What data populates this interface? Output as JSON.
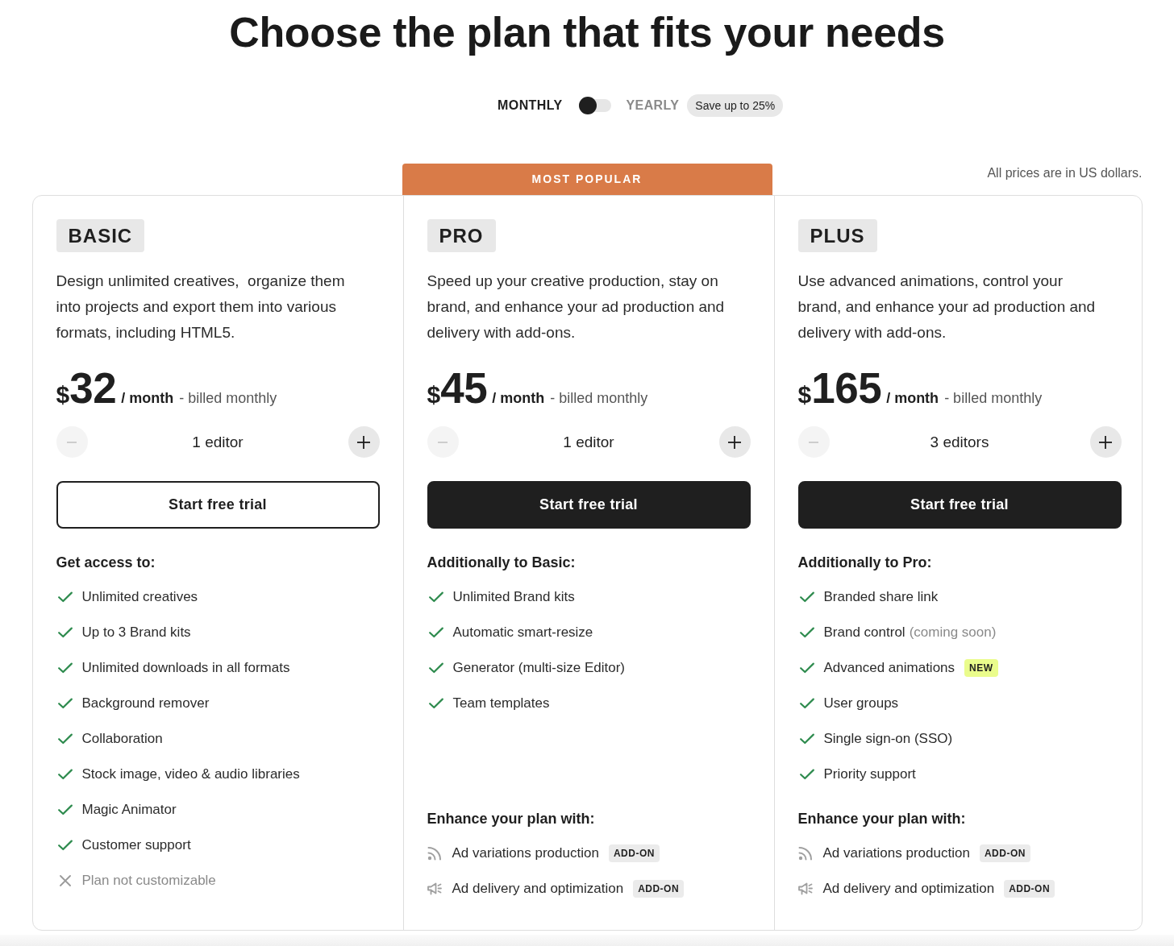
{
  "heading": "Choose the plan that fits your needs",
  "billing_toggle": {
    "options": [
      {
        "label": "MONTHLY",
        "selected": true
      },
      {
        "label": "YEARLY",
        "selected": false
      }
    ],
    "badge": "Save up to 25%"
  },
  "price_note": "All prices are in US dollars.",
  "plans": [
    {
      "name": "BASIC",
      "description": "Design unlimited creatives,  organize them into projects and export them into various formats, including HTML5.",
      "price": {
        "currency": "$",
        "amount": "32",
        "period": "/ month",
        "billing": "- billed monthly"
      },
      "stepper": {
        "label": "1 editor",
        "minus_disabled": true,
        "plus_disabled": false
      },
      "cta": {
        "label": "Start free trial",
        "kind": "outline"
      },
      "features_heading": "Get access to:",
      "features": [
        {
          "text": "Unlimited creatives",
          "included": true
        },
        {
          "text": "Up to 3 Brand kits",
          "included": true
        },
        {
          "text": "Unlimited downloads in all formats",
          "included": true
        },
        {
          "text": "Background remover",
          "included": true
        },
        {
          "text": "Collaboration",
          "included": true
        },
        {
          "text": "Stock image, video & audio libraries",
          "included": true
        },
        {
          "text": "Magic Animator",
          "included": true
        },
        {
          "text": "Customer support",
          "included": true
        },
        {
          "text": "Plan not customizable",
          "included": false
        }
      ]
    },
    {
      "name": "PRO",
      "ribbon": "MOST POPULAR",
      "description": "Speed up your creative production, stay on brand, and enhance your ad production and delivery with add-ons.",
      "price": {
        "currency": "$",
        "amount": "45",
        "period": "/ month",
        "billing": "- billed monthly"
      },
      "stepper": {
        "label": "1 editor",
        "minus_disabled": true,
        "plus_disabled": false
      },
      "cta": {
        "label": "Start free trial",
        "kind": "filled"
      },
      "features_heading": "Additionally to Basic:",
      "features": [
        {
          "text": "Unlimited Brand kits",
          "included": true
        },
        {
          "text": "Automatic smart-resize",
          "included": true
        },
        {
          "text": "Generator (multi-size Editor)",
          "included": true
        },
        {
          "text": "Team templates",
          "included": true
        }
      ],
      "addons_heading": "Enhance your plan with:",
      "addons": [
        {
          "text": "Ad variations production",
          "badge": "ADD-ON"
        },
        {
          "text": "Ad delivery and optimization",
          "badge": "ADD-ON"
        }
      ]
    },
    {
      "name": "PLUS",
      "description": "Use advanced animations, control your brand, and enhance your ad production and delivery with add-ons.",
      "price": {
        "currency": "$",
        "amount": "165",
        "period": "/ month",
        "billing": "- billed monthly"
      },
      "stepper": {
        "label": "3 editors",
        "minus_disabled": true,
        "plus_disabled": false
      },
      "cta": {
        "label": "Start free trial",
        "kind": "filled"
      },
      "features_heading": "Additionally to Pro:",
      "features": [
        {
          "text": "Branded share link",
          "included": true
        },
        {
          "text": "Brand control",
          "note": "(coming soon)",
          "included": true
        },
        {
          "text": "Advanced animations",
          "badge": "NEW",
          "included": true
        },
        {
          "text": "User groups",
          "included": true
        },
        {
          "text": "Single sign-on (SSO)",
          "included": true
        },
        {
          "text": "Priority support",
          "included": true
        }
      ],
      "addons_heading": "Enhance your plan with:",
      "addons": [
        {
          "text": "Ad variations production",
          "badge": "ADD-ON"
        },
        {
          "text": "Ad delivery and optimization",
          "badge": "ADD-ON"
        }
      ]
    }
  ]
}
